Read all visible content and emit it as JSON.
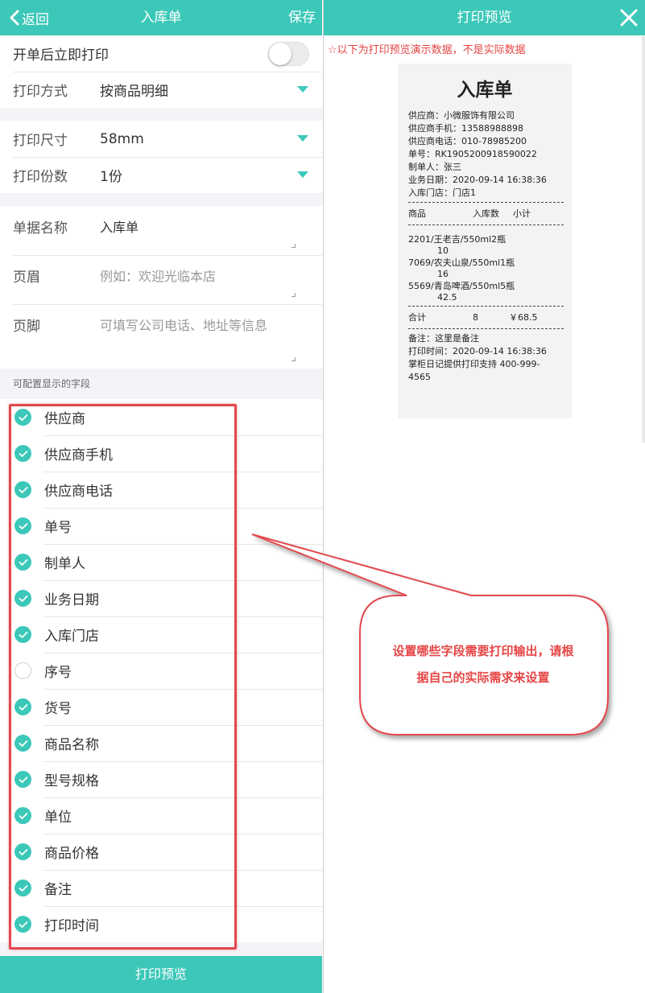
{
  "left": {
    "back_label": "返回",
    "title": "入库单",
    "save_label": "保存",
    "print_immediately": {
      "label": "开单后立即打印",
      "enabled": false
    },
    "print_mode": {
      "label": "打印方式",
      "value": "按商品明细"
    },
    "print_size": {
      "label": "打印尺寸",
      "value": "58mm"
    },
    "print_copies": {
      "label": "打印份数",
      "value": "1份"
    },
    "doc_name": {
      "label": "单据名称",
      "value": "入库单"
    },
    "header": {
      "label": "页眉",
      "placeholder": "例如：欢迎光临本店"
    },
    "footer": {
      "label": "页脚",
      "placeholder": "可填写公司电话、地址等信息"
    },
    "section_title": "可配置显示的字段",
    "fields": [
      {
        "label": "供应商",
        "checked": true
      },
      {
        "label": "供应商手机",
        "checked": true
      },
      {
        "label": "供应商电话",
        "checked": true
      },
      {
        "label": "单号",
        "checked": true
      },
      {
        "label": "制单人",
        "checked": true
      },
      {
        "label": "业务日期",
        "checked": true
      },
      {
        "label": "入库门店",
        "checked": true
      },
      {
        "label": "序号",
        "checked": false
      },
      {
        "label": "货号",
        "checked": true
      },
      {
        "label": "商品名称",
        "checked": true
      },
      {
        "label": "型号规格",
        "checked": true
      },
      {
        "label": "单位",
        "checked": true
      },
      {
        "label": "商品价格",
        "checked": true
      },
      {
        "label": "备注",
        "checked": true
      },
      {
        "label": "打印时间",
        "checked": true
      }
    ],
    "preview_button": "打印预览"
  },
  "right": {
    "title": "打印预览",
    "notice": "☆以下为打印预览演示数据，不是实际数据",
    "receipt": {
      "title": "入库单",
      "info": [
        "供应商：小微服饰有限公司",
        "供应商手机：13588988898",
        "供应商电话：010-78985200",
        "单号：RK1905200918590022",
        "制单人：张三",
        "业务日期：2020-09-14 16:38:36",
        "入库门店：门店1"
      ],
      "columns": [
        "商品",
        "入库数",
        "小计"
      ],
      "items": [
        {
          "name": "2201/王老吉/550ml2瓶",
          "qty": "10"
        },
        {
          "name": "7069/农夫山泉/550ml1瓶",
          "qty": "16"
        },
        {
          "name": "5569/青岛啤酒/550ml5瓶",
          "qty": "42.5"
        }
      ],
      "total": {
        "label": "合计",
        "qty": "8",
        "amount": "￥68.5"
      },
      "footer": [
        "备注：这里是备注",
        "打印时间：2020-09-14 16:38:36",
        "掌柜日记提供打印支持 400-999-",
        "4565"
      ]
    }
  },
  "callout": {
    "line1": "设置哪些字段需要打印输出，请根",
    "line2": "据自己的实际需求来设置"
  },
  "colors": {
    "accent": "#3cc8b9",
    "annotation_red": "#e2494e"
  }
}
